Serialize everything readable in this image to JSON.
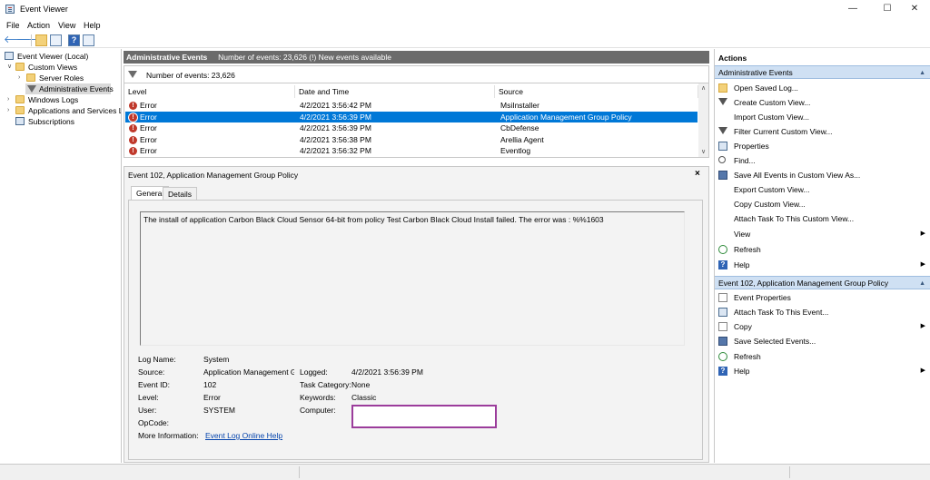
{
  "window": {
    "title": "Event Viewer"
  },
  "menu": {
    "file": "File",
    "action": "Action",
    "view": "View",
    "help": "Help"
  },
  "tree": {
    "items": [
      {
        "label": "Event Viewer (Local)"
      },
      {
        "label": "Custom Views"
      },
      {
        "label": "Server Roles"
      },
      {
        "label": "Administrative Events"
      },
      {
        "label": "Windows Logs"
      },
      {
        "label": "Applications and Services Lo"
      },
      {
        "label": "Subscriptions"
      }
    ]
  },
  "center": {
    "header_title": "Administrative Events",
    "header_info": "Number of events: 23,626 (!) New events available",
    "count_text": "Number of events: 23,626",
    "columns": {
      "level": "Level",
      "datetime": "Date and Time",
      "source": "Source"
    },
    "rows": [
      {
        "level": "Error",
        "datetime": "4/2/2021 3:56:42 PM",
        "source": "MsiInstaller"
      },
      {
        "level": "Error",
        "datetime": "4/2/2021 3:56:39 PM",
        "source": "Application Management Group Policy"
      },
      {
        "level": "Error",
        "datetime": "4/2/2021 3:56:39 PM",
        "source": "CbDefense"
      },
      {
        "level": "Error",
        "datetime": "4/2/2021 3:56:38 PM",
        "source": "Arellia Agent"
      },
      {
        "level": "Error",
        "datetime": "4/2/2021 3:56:32 PM",
        "source": "Eventlog"
      }
    ]
  },
  "detail": {
    "title": "Event 102, Application Management Group Policy",
    "close": "×",
    "tabs": {
      "general": "General",
      "details": "Details"
    },
    "description": "The install of application Carbon Black Cloud Sensor 64-bit from policy Test Carbon Black Cloud Install failed.  The error was : %%1603",
    "props": {
      "log_name_label": "Log Name:",
      "log_name": "System",
      "source_label": "Source:",
      "source": "Application Management Gr",
      "logged_label": "Logged:",
      "logged": "4/2/2021 3:56:39 PM",
      "event_id_label": "Event ID:",
      "event_id": "102",
      "task_label": "Task Category:",
      "task": "None",
      "level_label": "Level:",
      "level": "Error",
      "keywords_label": "Keywords:",
      "keywords": "Classic",
      "user_label": "User:",
      "user": "SYSTEM",
      "computer_label": "Computer:",
      "opcode_label": "OpCode:",
      "more_info_label": "More Information:",
      "more_info_link": "Event Log Online Help"
    }
  },
  "actions": {
    "title": "Actions",
    "section1": "Administrative Events",
    "section1_items": [
      {
        "label": "Open Saved Log...",
        "icon": "folder-icon"
      },
      {
        "label": "Create Custom View...",
        "icon": "filter-icon"
      },
      {
        "label": "Import Custom View...",
        "icon": ""
      },
      {
        "label": "Filter Current Custom View...",
        "icon": "filter-icon"
      },
      {
        "label": "Properties",
        "icon": "properties-icon"
      },
      {
        "label": "Find...",
        "icon": "find-icon"
      },
      {
        "label": "Save All Events in Custom View As...",
        "icon": "save-icon"
      },
      {
        "label": "Export Custom View...",
        "icon": ""
      },
      {
        "label": "Copy Custom View...",
        "icon": ""
      },
      {
        "label": "Attach Task To This Custom View...",
        "icon": ""
      },
      {
        "label": "View",
        "icon": ""
      },
      {
        "label": "Refresh",
        "icon": "refresh-icon"
      },
      {
        "label": "Help",
        "icon": "help-icon"
      }
    ],
    "section2": "Event 102, Application Management Group Policy",
    "section2_items": [
      {
        "label": "Event Properties",
        "icon": "page-icon"
      },
      {
        "label": "Attach Task To This Event...",
        "icon": "task-icon"
      },
      {
        "label": "Copy",
        "icon": "copy-icon"
      },
      {
        "label": "Save Selected Events...",
        "icon": "save-icon"
      },
      {
        "label": "Refresh",
        "icon": "refresh-icon"
      },
      {
        "label": "Help",
        "icon": "help-icon"
      }
    ]
  },
  "colors": {
    "selection": "#0078d7",
    "section": "#cfe0f3",
    "header": "#6b6b6b",
    "highlight_box": "#9b3c9b"
  }
}
